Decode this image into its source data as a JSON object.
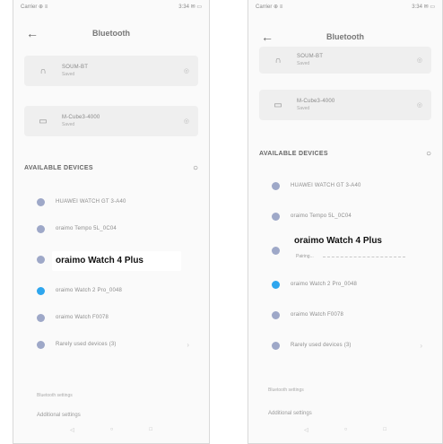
{
  "left_screen": {
    "status_left": "Carrier ⊕ ≡",
    "status_right": "3:34 ✉ ▭",
    "title": "Bluetooth",
    "paired": [
      {
        "icon": "headphones-icon",
        "name": "SOUM-BT",
        "sub": "Saved"
      },
      {
        "icon": "car-icon",
        "name": "M-Cube3-4000",
        "sub": "Saved"
      }
    ],
    "available_label": "AVAILABLE DEVICES",
    "devices": [
      {
        "name": "HUAWEI WATCH GT 3-A40",
        "color": "#9ea8c8"
      },
      {
        "name": "oraimo Tempo 5L_0C04",
        "color": "#9ea8c8"
      },
      {
        "name": "oraimo Watch 4 Plus",
        "color": "#9ea8c8",
        "highlight": true
      },
      {
        "name": "oraimo Watch 2 Pro_0048",
        "color": "#2ea6ee"
      },
      {
        "name": "oraimo Watch F0078",
        "color": "#9ea8c8"
      },
      {
        "name": "Rarely used devices (3)",
        "color": "#9ea8c8"
      }
    ],
    "footer_small": "Bluetooth settings",
    "additional_settings": "Additional settings"
  },
  "right_screen": {
    "status_left": "Carrier ⊕ ≡",
    "status_right": "3:34 ✉ ▭",
    "title": "Bluetooth",
    "paired": [
      {
        "icon": "headphones-icon",
        "name": "SOUM-BT",
        "sub": "Saved"
      },
      {
        "icon": "car-icon",
        "name": "M-Cube3-4000",
        "sub": "Saved"
      }
    ],
    "available_label": "AVAILABLE DEVICES",
    "devices": [
      {
        "name": "HUAWEI WATCH GT 3-A40",
        "color": "#9ea8c8"
      },
      {
        "name": "oraimo Tempo 5L_0C04",
        "color": "#9ea8c8"
      },
      {
        "name": "oraimo Watch 4 Plus",
        "sub": "Pairing...",
        "color": "#9ea8c8",
        "highlight": true
      },
      {
        "name": "oraimo Watch 2 Pro_0048",
        "color": "#2ea6ee"
      },
      {
        "name": "oraimo Watch F0078",
        "color": "#9ea8c8"
      },
      {
        "name": "Rarely used devices (3)",
        "color": "#9ea8c8"
      }
    ],
    "footer_small": "Bluetooth settings",
    "additional_settings": "Additional settings"
  }
}
